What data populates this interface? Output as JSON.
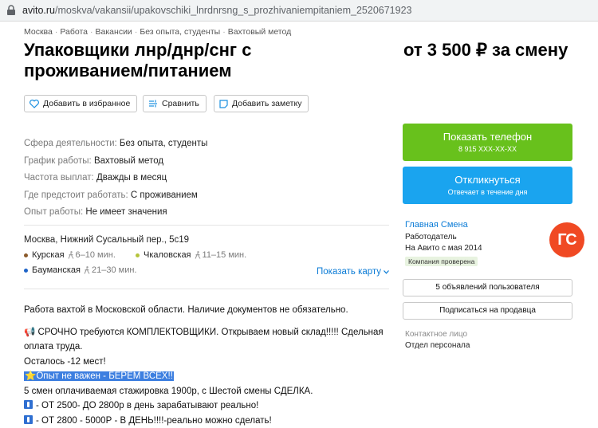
{
  "browser": {
    "url_host": "avito.ru",
    "url_path": "/moskva/vakansii/upakovschiki_lnrdnrsng_s_prozhivaniempitaniem_2520671923"
  },
  "breadcrumb": [
    "Москва",
    "Работа",
    "Вакансии",
    "Без опыта, студенты",
    "Вахтовый метод"
  ],
  "title": "Упаковщики лнр/днр/снг с проживанием/питанием",
  "price": "от 3 500 ₽ за смену",
  "actions": {
    "favorite": "Добавить в избранное",
    "compare": "Сравнить",
    "note": "Добавить заметку"
  },
  "params": [
    {
      "label": "Сфера деятельности:",
      "value": "Без опыта, студенты"
    },
    {
      "label": "График работы:",
      "value": "Вахтовый метод"
    },
    {
      "label": "Частота выплат:",
      "value": "Дважды в месяц"
    },
    {
      "label": "Где предстоит работать:",
      "value": "С проживанием"
    },
    {
      "label": "Опыт работы:",
      "value": "Не имеет значения"
    }
  ],
  "address": "Москва, Нижний Сусальный пер., 5с19",
  "metro": [
    {
      "name": "Курская",
      "time": "6–10 мин.",
      "color": "#8b5a2b"
    },
    {
      "name": "Чкаловская",
      "time": "11–15 мин.",
      "color": "#b5c43b"
    },
    {
      "name": "Бауманская",
      "time": "21–30 мин.",
      "color": "#1e64c8"
    }
  ],
  "show_map": "Показать карту",
  "description": {
    "line1": "Работа вахтой в Московской области. Наличие документов не обязательно.",
    "line2": "📢 СРОЧНО требуются КОМПЛЕКТОВЩИКИ. Открываем новый склад!!!!! Сдельная оплата труда.",
    "line3": "Осталось -12 мест!",
    "line4": "⭐Опыт не важен - БЕРЕМ ВСЕХ!!",
    "line5": "5 смен оплачиваемая стажировка 1900р, с Шестой смены СДЕЛКА.",
    "line6": "- ОТ 2500- ДО 2800р в день зарабатывают реально!",
    "line7": "- ОТ 2800 - 5000Р - В ДЕНЬ!!!!-реально можно сделать!"
  },
  "phone_button": {
    "label": "Показать телефон",
    "sub": "8 915 XXX-XX-XX"
  },
  "respond_button": {
    "label": "Откликнуться",
    "sub": "Отвечает в течение дня"
  },
  "seller": {
    "name": "Главная Смена",
    "role": "Работодатель",
    "since": "На Авито с мая 2014",
    "verified": "Компания проверена",
    "logo_text": "ГС"
  },
  "seller_buttons": {
    "ads": "5 объявлений пользователя",
    "subscribe": "Подписаться на продавца"
  },
  "contact": {
    "label": "Контактное лицо",
    "value": "Отдел персонала"
  },
  "colors": {
    "green": "#68c11c",
    "blue": "#1aa4ef",
    "link": "#0a7bd6",
    "logo": "#f04923"
  }
}
